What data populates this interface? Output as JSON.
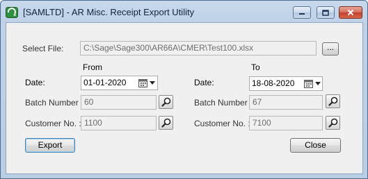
{
  "window": {
    "title": "[SAMLTD] - AR Misc. Receipt Export Utility"
  },
  "file": {
    "label": "Select File:",
    "path": "C:\\Sage\\Sage300\\AR66A\\CMER\\Test100.xlsx",
    "browse_label": "..."
  },
  "from": {
    "heading": "From",
    "date_label": "Date:",
    "date_value": "01-01-2020",
    "batch_label": "Batch Number :",
    "batch_value": "60",
    "customer_label": "Customer No. :",
    "customer_value": "1100"
  },
  "to": {
    "heading": "To",
    "date_label": "Date:",
    "date_value": "18-08-2020",
    "batch_label": "Batch Number :",
    "batch_value": "67",
    "customer_label": "Customer No. :",
    "customer_value": "7100"
  },
  "actions": {
    "export_label": "Export",
    "close_label": "Close"
  }
}
